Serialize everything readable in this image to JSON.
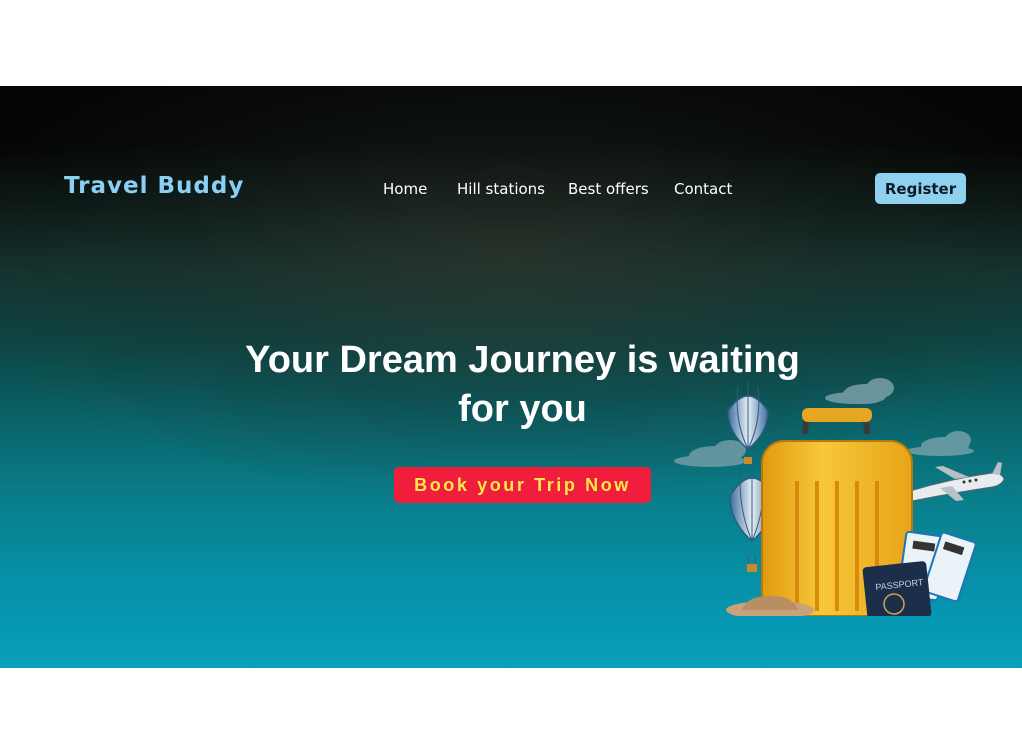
{
  "brand": {
    "name": "Travel Buddy"
  },
  "nav": {
    "links": [
      "Home",
      "Hill stations",
      "Best offers",
      "Contact"
    ],
    "register_label": "Register"
  },
  "hero": {
    "headline": "Your Dream Journey is waiting for you",
    "cta_label": "Book your Trip Now",
    "passport_text": "PASSPORT"
  },
  "colors": {
    "brand_text": "#8ad0f2",
    "register_bg": "#8fd2f0",
    "cta_bg": "#f11d3c",
    "cta_text": "#ffe94a"
  }
}
